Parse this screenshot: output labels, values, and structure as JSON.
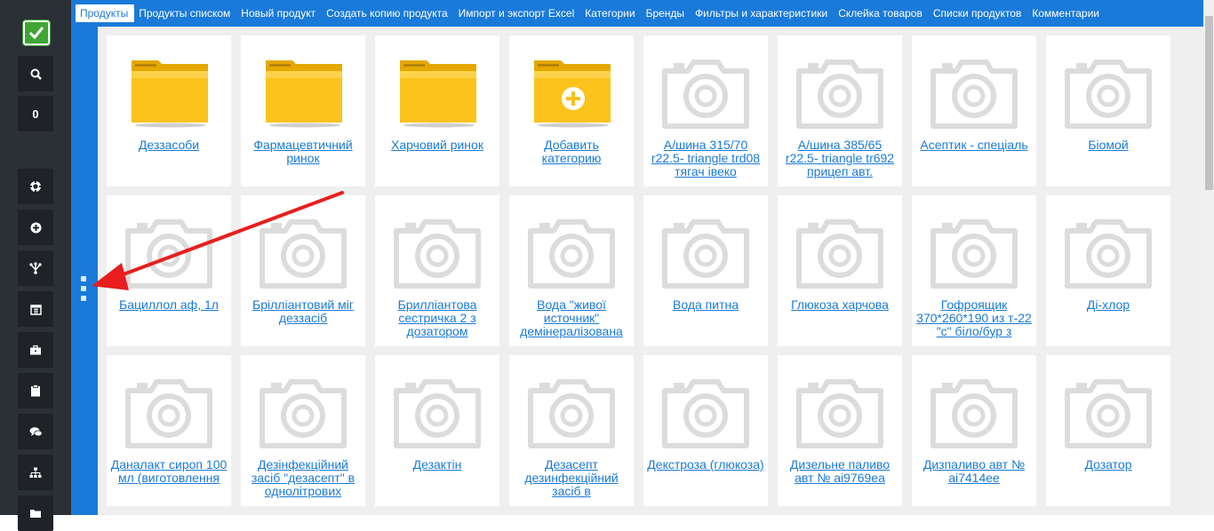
{
  "sidebar": {
    "counter": "0",
    "icons": [
      "check-icon",
      "search-icon",
      "lifebuoy-icon",
      "plus-circle-icon",
      "fork-icon",
      "calendar-icon",
      "briefcase-icon",
      "clipboard-icon",
      "comments-icon",
      "sitemap-icon",
      "folder-icon"
    ]
  },
  "tabs": [
    {
      "label": "Продукты",
      "active": true
    },
    {
      "label": "Продукты списком"
    },
    {
      "label": "Новый продукт"
    },
    {
      "label": "Создать копию продукта"
    },
    {
      "label": "Импорт и экспорт Excel"
    },
    {
      "label": "Категории"
    },
    {
      "label": "Бренды"
    },
    {
      "label": "Фильтры и характеристики"
    },
    {
      "label": "Склейка товаров"
    },
    {
      "label": "Списки продуктов"
    },
    {
      "label": "Комментарии"
    }
  ],
  "rows": [
    [
      {
        "type": "folder",
        "label": "Деззасоби"
      },
      {
        "type": "folder",
        "label": "Фармацевтичний ринок"
      },
      {
        "type": "folder",
        "label": "Харчовий ринок"
      },
      {
        "type": "folder-add",
        "label": "Добавить категорию"
      },
      {
        "type": "photo",
        "label": "А/шина 315/70 r22.5- triangle trd08 тягач івеко"
      },
      {
        "type": "photo",
        "label": "А/шина 385/65 r22.5- triangle tr692 прицеп авт."
      },
      {
        "type": "photo",
        "label": "Асептик - спеціаль"
      },
      {
        "type": "photo",
        "label": "Біомой"
      }
    ],
    [
      {
        "type": "photo",
        "label": "Бациллол аф, 1л"
      },
      {
        "type": "photo",
        "label": "Брілліантовий міг деззасіб"
      },
      {
        "type": "photo",
        "label": "Брилліантова сестричка 2 з дозатором"
      },
      {
        "type": "photo",
        "label": "Вода \"живої источник\" демінералізована"
      },
      {
        "type": "photo",
        "label": "Вода питна"
      },
      {
        "type": "photo",
        "label": "Глюкоза харчова"
      },
      {
        "type": "photo",
        "label": "Гофроящик 370*260*190 из т-22 \"с\" біло/бур з"
      },
      {
        "type": "photo",
        "label": "Ді-хлор"
      }
    ],
    [
      {
        "type": "photo",
        "label": "Даналакт сироп 100 мл (виготовлення"
      },
      {
        "type": "photo",
        "label": "Дезінфекційний засіб \"дезасепт\" в однолітрових"
      },
      {
        "type": "photo",
        "label": "Дезактін"
      },
      {
        "type": "photo",
        "label": "Дезасепт дезинфекційний засіб в"
      },
      {
        "type": "photo",
        "label": "Декстроза (глюкоза)"
      },
      {
        "type": "photo",
        "label": "Дизельне паливо авт № аі9769еа"
      },
      {
        "type": "photo",
        "label": "Дизпаливо авт № аі7414ее"
      },
      {
        "type": "photo",
        "label": "Дозатор"
      }
    ]
  ],
  "colors": {
    "accent": "#1a7ad9",
    "sidebar": "#2b2f36",
    "folder": "#f9c21b",
    "arrow": "#e81e1e"
  }
}
